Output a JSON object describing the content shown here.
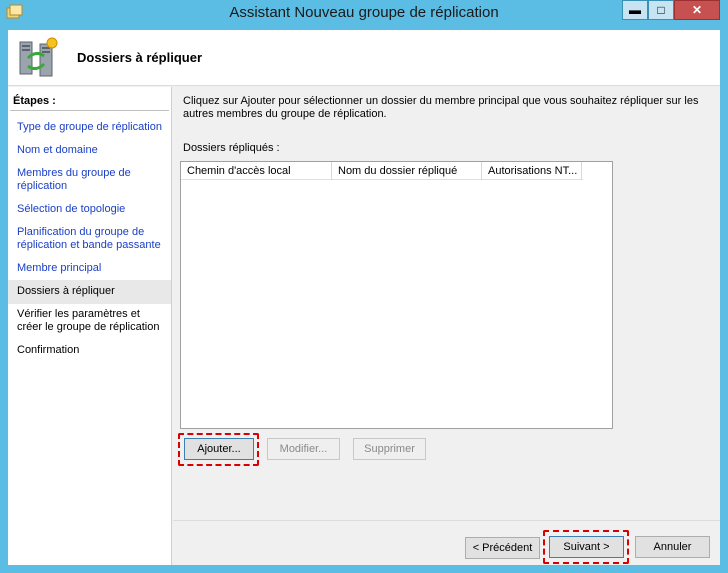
{
  "window": {
    "title": "Assistant Nouveau groupe de réplication",
    "minimize_glyph": "▬",
    "maximize_glyph": "□",
    "close_glyph": "✕"
  },
  "header": {
    "title": "Dossiers à répliquer",
    "icon": "server-replication-icon"
  },
  "steps": {
    "title": "Étapes :",
    "items": [
      {
        "label": "Type de groupe de réplication",
        "state": "link"
      },
      {
        "label": "Nom et domaine",
        "state": "link"
      },
      {
        "label": "Membres du groupe de réplication",
        "state": "link"
      },
      {
        "label": "Sélection de topologie",
        "state": "link"
      },
      {
        "label": "Planification du groupe de réplication et bande passante",
        "state": "link"
      },
      {
        "label": "Membre principal",
        "state": "link"
      },
      {
        "label": "Dossiers à répliquer",
        "state": "current"
      },
      {
        "label": "Vérifier les paramètres et créer le groupe de réplication",
        "state": "plain"
      },
      {
        "label": "Confirmation",
        "state": "plain"
      }
    ]
  },
  "main": {
    "description": "Cliquez sur Ajouter pour sélectionner un dossier du membre principal que vous souhaitez répliquer sur les autres membres du groupe de réplication.",
    "list_label": "Dossiers répliqués :",
    "columns": [
      "Chemin d'accès local",
      "Nom du dossier répliqué",
      "Autorisations NT..."
    ],
    "rows": [],
    "add_label": "Ajouter...",
    "modify_label": "Modifier...",
    "delete_label": "Supprimer"
  },
  "footer": {
    "previous_label": "< Précédent",
    "next_label": "Suivant >",
    "cancel_label": "Annuler"
  },
  "colors": {
    "title_bar": "#5bbde4",
    "link": "#1a3fc4",
    "highlight": "#d80000",
    "close_button": "#c75050"
  }
}
